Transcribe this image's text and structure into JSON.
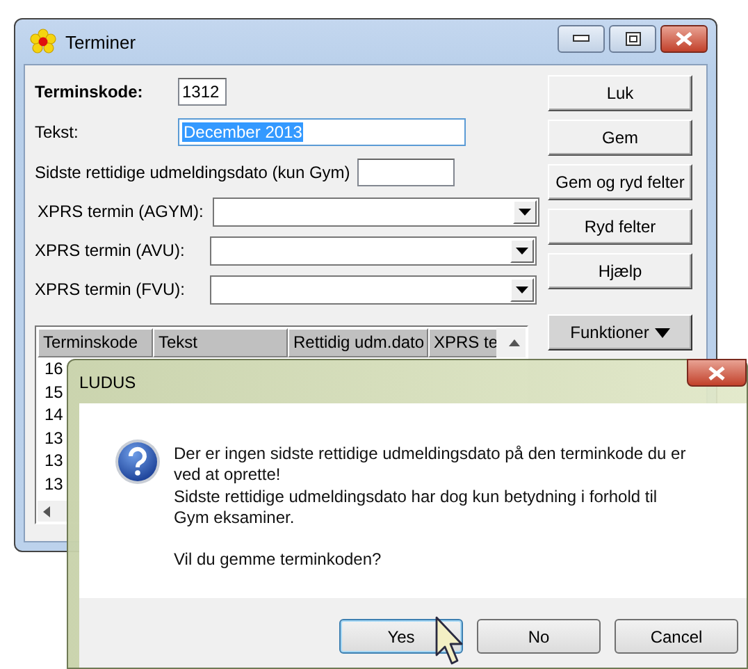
{
  "main_window": {
    "title": "Terminer",
    "fields": [
      {
        "kind": "input",
        "label": "Terminskode:",
        "bold": true,
        "value": "1312",
        "selected": false
      },
      {
        "kind": "input",
        "label": "Tekst:",
        "bold": false,
        "value": "December 2013",
        "selected": true
      },
      {
        "kind": "input",
        "label": "Sidste rettidige udmeldingsdato (kun Gym)",
        "bold": false,
        "selected": false
      },
      {
        "kind": "dropdown",
        "label": "XPRS termin (AGYM):",
        "bold": false
      },
      {
        "kind": "dropdown",
        "label": "XPRS termin (AVU):",
        "bold": false
      },
      {
        "kind": "dropdown",
        "label": "XPRS termin (FVU):",
        "bold": false
      }
    ],
    "buttons": [
      {
        "kind": "push",
        "label": "Luk"
      },
      {
        "kind": "push",
        "label": "Gem"
      },
      {
        "kind": "push",
        "label": "Gem og ryd felter"
      },
      {
        "kind": "push",
        "label": "Ryd felter"
      },
      {
        "kind": "push",
        "label": "Hjælp"
      },
      {
        "kind": "menu",
        "label": "Funktioner"
      }
    ],
    "table": {
      "columns": [
        "Terminskode",
        "Tekst",
        "Rettidig udm.dato",
        "XPRS te"
      ],
      "rows": [
        {
          "column_1": "16"
        },
        {
          "column_1": "15"
        },
        {
          "column_1": "14"
        },
        {
          "column_1": "13"
        },
        {
          "column_1": "13"
        },
        {
          "column_1": "13"
        }
      ]
    }
  },
  "dialog": {
    "title": "LUDUS",
    "message_lines": [
      "Der er ingen sidste rettidige udmeldingsdato på den terminkode du er",
      "ved at oprette!",
      "Sidste rettidige udmeldingsdato har dog kun betydning i forhold til",
      "Gym eksaminer."
    ],
    "question": "Vil du gemme terminkoden?",
    "buttons": [
      {
        "label": "Yes",
        "selected": true
      },
      {
        "label": "No",
        "selected": false
      },
      {
        "label": "Cancel",
        "selected": false
      }
    ]
  }
}
